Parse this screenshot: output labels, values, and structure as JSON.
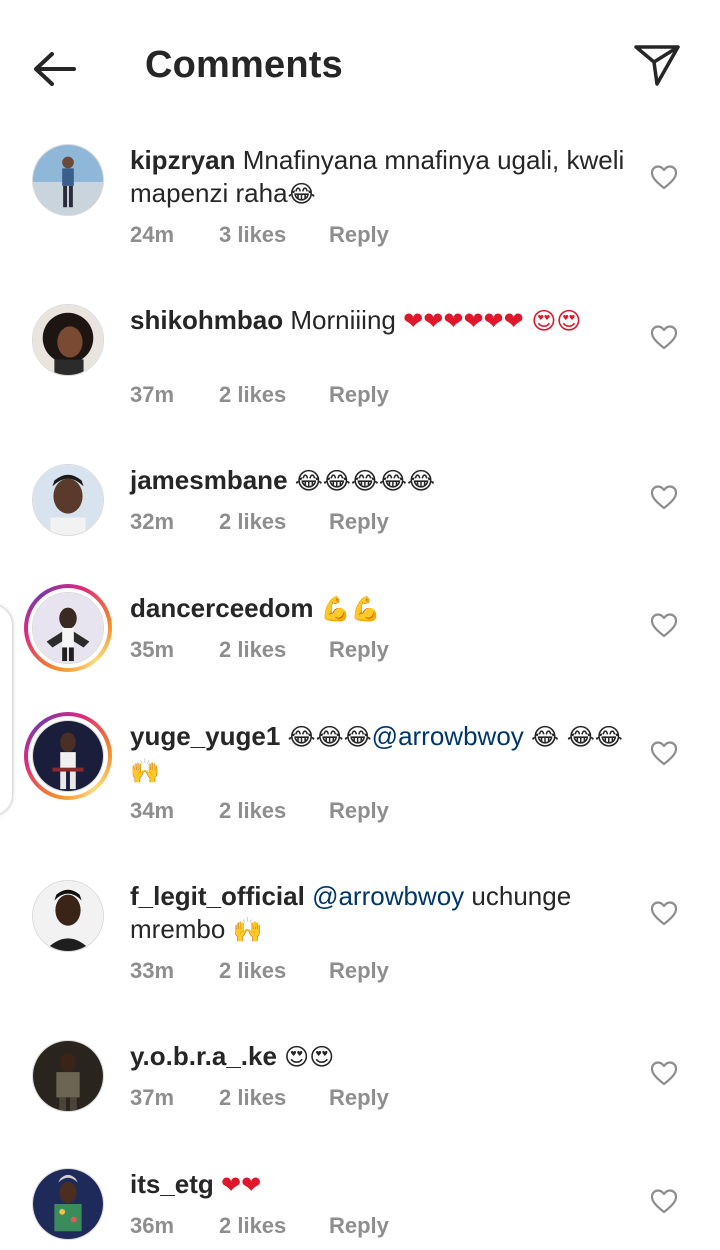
{
  "header": {
    "title": "Comments",
    "back_icon": "arrow-left-icon",
    "send_icon": "paper-plane-icon"
  },
  "colors": {
    "text": "#262626",
    "secondary": "#8e8e8e",
    "mention": "#00376b",
    "heart_emoji": "#e0162b"
  },
  "comments": [
    {
      "username": "kipzryan",
      "text": "Mnafinyana mnafinya ugali, kweli mapenzi raha",
      "emoji": "😂",
      "time": "24m",
      "likes": "3 likes",
      "reply": "Reply"
    },
    {
      "username": "shikohmbao",
      "text": "Morniiing",
      "emoji": "❤❤❤❤❤❤ 😍😍",
      "time": "37m",
      "likes": "2 likes",
      "reply": "Reply"
    },
    {
      "username": "jamesmbane",
      "text": "",
      "emoji": "😂😂😂😂😂",
      "time": "32m",
      "likes": "2 likes",
      "reply": "Reply"
    },
    {
      "username": "dancerceedom",
      "text": "",
      "emoji": "💪💪",
      "time": "35m",
      "likes": "2 likes",
      "reply": "Reply"
    },
    {
      "username": "yuge_yuge1",
      "emoji_pre": "😂😂😂",
      "mention": "@arrowbwoy",
      "emoji": "😂 😂😂🙌",
      "time": "34m",
      "likes": "2 likes",
      "reply": "Reply"
    },
    {
      "username": "f_legit_official",
      "mention": "@arrowbwoy",
      "text": "uchunge mrembo",
      "emoji": "🙌",
      "time": "33m",
      "likes": "2 likes",
      "reply": "Reply"
    },
    {
      "username": "y.o.b.r.a_.ke",
      "text": "",
      "emoji": "😍😍",
      "time": "37m",
      "likes": "2 likes",
      "reply": "Reply"
    },
    {
      "username": "its_etg",
      "text": "",
      "emoji": "❤❤",
      "time": "36m",
      "likes": "2 likes",
      "reply": "Reply"
    }
  ]
}
